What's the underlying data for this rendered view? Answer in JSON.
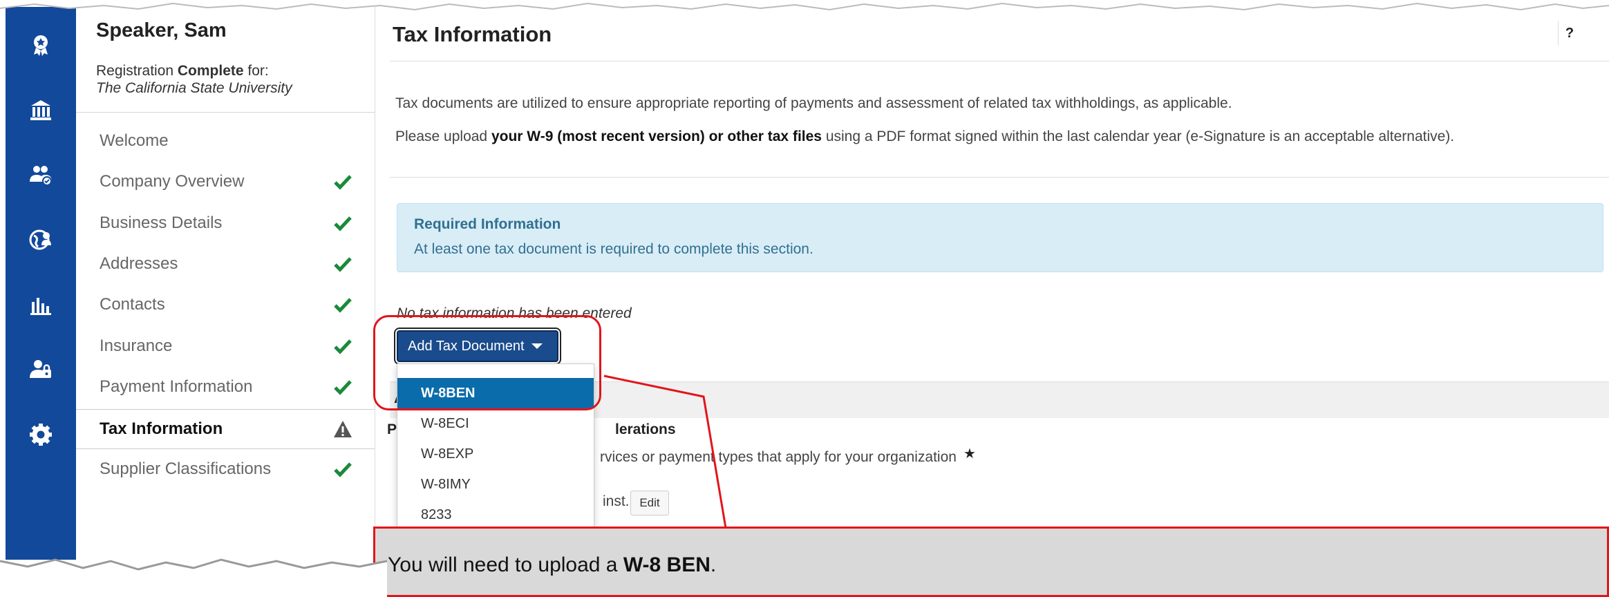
{
  "sidebar": {
    "user_name": "Speaker, Sam",
    "registration_prefix": "Registration ",
    "registration_status": "Complete",
    "registration_suffix": " for:",
    "university": "The California State University",
    "items": [
      {
        "label": "Welcome",
        "status": "none"
      },
      {
        "label": "Company Overview",
        "status": "complete"
      },
      {
        "label": "Business Details",
        "status": "complete"
      },
      {
        "label": "Addresses",
        "status": "complete"
      },
      {
        "label": "Contacts",
        "status": "complete"
      },
      {
        "label": "Insurance",
        "status": "complete"
      },
      {
        "label": "Payment Information",
        "status": "complete"
      },
      {
        "label": "Tax Information",
        "status": "warning"
      },
      {
        "label": "Supplier Classifications",
        "status": "complete"
      }
    ]
  },
  "rail_icons": [
    "award-icon",
    "bank-icon",
    "users-icon",
    "globe-user-icon",
    "bar-chart-icon",
    "user-lock-icon",
    "gear-icon"
  ],
  "main": {
    "title": "Tax Information",
    "help_label": "?",
    "description_1": "Tax documents are utilized to ensure appropriate reporting of payments and assessment of related tax withholdings, as applicable.",
    "description_2_pre": "Please upload ",
    "description_2_bold": "your W-9 (most recent version) or other tax files",
    "description_2_post": " using a PDF format signed within the last calendar year (e-Signature is an acceptable alternative).",
    "alert_title": "Required Information",
    "alert_body": "At least one tax document is required to complete this section.",
    "empty_note": "No tax information has been entered",
    "add_button_label": "Add Tax Document",
    "section_letter": "A",
    "section_head_prefix": "P",
    "section_head_tail": "lerations",
    "services_text": "rvices or payment types that apply for your organization",
    "required_star": "★",
    "inst_text": "inst...",
    "edit_label": "Edit"
  },
  "dropdown": {
    "options": [
      "W-8BEN",
      "W-8ECI",
      "W-8EXP",
      "W-8IMY",
      "8233"
    ],
    "selected": "W-8BEN"
  },
  "callout": {
    "text_pre": "You will need to upload a ",
    "text_bold": "W-8 BEN",
    "text_post": "."
  },
  "colors": {
    "rail": "#12499a",
    "accent_button": "#1a4b8c",
    "selected_option": "#0b6cab",
    "check": "#1a8a3a",
    "highlight": "#e2141b",
    "alert_bg": "#d9edf7"
  }
}
